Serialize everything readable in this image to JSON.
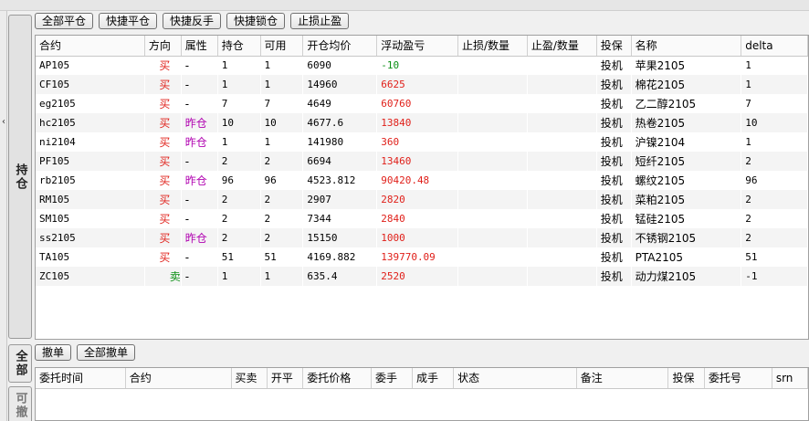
{
  "side_tabs": {
    "positions": "持仓",
    "all": "全部",
    "cancellable": "可撤"
  },
  "collapse_arrow": "‹",
  "top_toolbar": {
    "close_all": "全部平仓",
    "quick_close": "快捷平仓",
    "quick_reverse": "快捷反手",
    "quick_lock": "快捷锁仓",
    "stop_loss_take_profit": "止损止盈"
  },
  "bottom_toolbar": {
    "cancel": "撤单",
    "cancel_all": "全部撤单"
  },
  "positions": {
    "columns": [
      "合约",
      "方向",
      "属性",
      "持仓",
      "可用",
      "开仓均价",
      "浮动盈亏",
      "止损/数量",
      "止盈/数量",
      "投保",
      "名称",
      "delta"
    ],
    "rows": [
      {
        "contract": "AP105",
        "direction": "买",
        "attr": "-",
        "hold": "1",
        "avail": "1",
        "avg": "6090",
        "pnl": "-10",
        "sl": "",
        "tp": "",
        "hedge": "投机",
        "name": "苹果2105",
        "delta": "1"
      },
      {
        "contract": "CF105",
        "direction": "买",
        "attr": "-",
        "hold": "1",
        "avail": "1",
        "avg": "14960",
        "pnl": "6625",
        "sl": "",
        "tp": "",
        "hedge": "投机",
        "name": "棉花2105",
        "delta": "1"
      },
      {
        "contract": "eg2105",
        "direction": "买",
        "attr": "-",
        "hold": "7",
        "avail": "7",
        "avg": "4649",
        "pnl": "60760",
        "sl": "",
        "tp": "",
        "hedge": "投机",
        "name": "乙二醇2105",
        "delta": "7"
      },
      {
        "contract": "hc2105",
        "direction": "买",
        "attr": "昨仓",
        "hold": "10",
        "avail": "10",
        "avg": "4677.6",
        "pnl": "13840",
        "sl": "",
        "tp": "",
        "hedge": "投机",
        "name": "热卷2105",
        "delta": "10"
      },
      {
        "contract": "ni2104",
        "direction": "买",
        "attr": "昨仓",
        "hold": "1",
        "avail": "1",
        "avg": "141980",
        "pnl": "360",
        "sl": "",
        "tp": "",
        "hedge": "投机",
        "name": "沪镍2104",
        "delta": "1"
      },
      {
        "contract": "PF105",
        "direction": "买",
        "attr": "-",
        "hold": "2",
        "avail": "2",
        "avg": "6694",
        "pnl": "13460",
        "sl": "",
        "tp": "",
        "hedge": "投机",
        "name": "短纤2105",
        "delta": "2"
      },
      {
        "contract": "rb2105",
        "direction": "买",
        "attr": "昨仓",
        "hold": "96",
        "avail": "96",
        "avg": "4523.812",
        "pnl": "90420.48",
        "sl": "",
        "tp": "",
        "hedge": "投机",
        "name": "螺纹2105",
        "delta": "96"
      },
      {
        "contract": "RM105",
        "direction": "买",
        "attr": "-",
        "hold": "2",
        "avail": "2",
        "avg": "2907",
        "pnl": "2820",
        "sl": "",
        "tp": "",
        "hedge": "投机",
        "name": "菜粕2105",
        "delta": "2"
      },
      {
        "contract": "SM105",
        "direction": "买",
        "attr": "-",
        "hold": "2",
        "avail": "2",
        "avg": "7344",
        "pnl": "2840",
        "sl": "",
        "tp": "",
        "hedge": "投机",
        "name": "锰硅2105",
        "delta": "2"
      },
      {
        "contract": "ss2105",
        "direction": "买",
        "attr": "昨仓",
        "hold": "2",
        "avail": "2",
        "avg": "15150",
        "pnl": "1000",
        "sl": "",
        "tp": "",
        "hedge": "投机",
        "name": "不锈钢2105",
        "delta": "2"
      },
      {
        "contract": "TA105",
        "direction": "买",
        "attr": "-",
        "hold": "51",
        "avail": "51",
        "avg": "4169.882",
        "pnl": "139770.09",
        "sl": "",
        "tp": "",
        "hedge": "投机",
        "name": "PTA2105",
        "delta": "51"
      },
      {
        "contract": "ZC105",
        "direction": "卖",
        "attr": "-",
        "hold": "1",
        "avail": "1",
        "avg": "635.4",
        "pnl": "2520",
        "sl": "",
        "tp": "",
        "hedge": "投机",
        "name": "动力煤2105",
        "delta": "-1"
      }
    ]
  },
  "orders": {
    "columns": [
      "委托时间",
      "合约",
      "买卖",
      "开平",
      "委托价格",
      "委手",
      "成手",
      "状态",
      "备注",
      "投保",
      "委托号",
      "srn"
    ]
  },
  "colors": {
    "buy": "#e0201a",
    "sell": "#0a8f14",
    "profit": "#e0201a",
    "loss": "#0a8f14",
    "yesterday_position": "#b000b0"
  }
}
